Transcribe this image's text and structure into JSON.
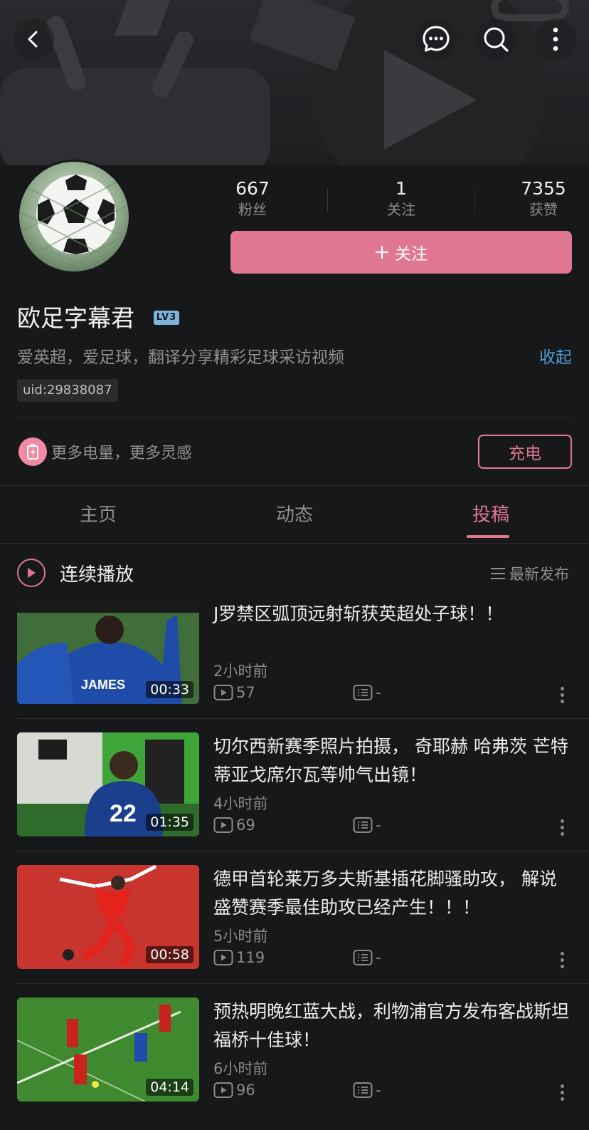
{
  "profile": {
    "name": "欧足字幕君",
    "level": "LV3",
    "bio": "爱英超，爱足球，翻译分享精彩足球采访视频",
    "collapse_label": "收起",
    "uid": "uid:29838087"
  },
  "stats": [
    {
      "value": "667",
      "label": "粉丝"
    },
    {
      "value": "1",
      "label": "关注"
    },
    {
      "value": "7355",
      "label": "获赞"
    }
  ],
  "follow_label": "关注",
  "charge": {
    "text": "更多电量，更多灵感",
    "button": "充电"
  },
  "tabs": [
    {
      "label": "主页",
      "active": false
    },
    {
      "label": "动态",
      "active": false
    },
    {
      "label": "投稿",
      "active": true
    }
  ],
  "list_header": {
    "play_all": "连续播放",
    "sort": "最新发布"
  },
  "videos": [
    {
      "title": "J罗禁区弧顶远射斩获英超处子球！！",
      "duration": "00:33",
      "time": "2小时前",
      "views": "57",
      "danmaku": "-"
    },
    {
      "title": "切尔西新赛季照片拍摄， 奇耶赫  哈弗茨  芒特  蒂亚戈席尔瓦等帅气出镜！",
      "duration": "01:35",
      "time": "4小时前",
      "views": "69",
      "danmaku": "-"
    },
    {
      "title": "德甲首轮莱万多夫斯基插花脚骚助攻， 解说盛赞赛季最佳助攻已经产生！！！",
      "duration": "00:58",
      "time": "5小时前",
      "views": "119",
      "danmaku": "-"
    },
    {
      "title": "预热明晚红蓝大战，利物浦官方发布客战斯坦福桥十佳球！",
      "duration": "04:14",
      "time": "6小时前",
      "views": "96",
      "danmaku": "-"
    }
  ],
  "colors": {
    "accent": "#e07791",
    "link": "#4a9fd8",
    "background": "#17181a"
  },
  "icons": {
    "back": "chevron-left-icon",
    "message": "chat-bubble-icon",
    "search": "search-icon",
    "more": "more-vertical-icon"
  }
}
